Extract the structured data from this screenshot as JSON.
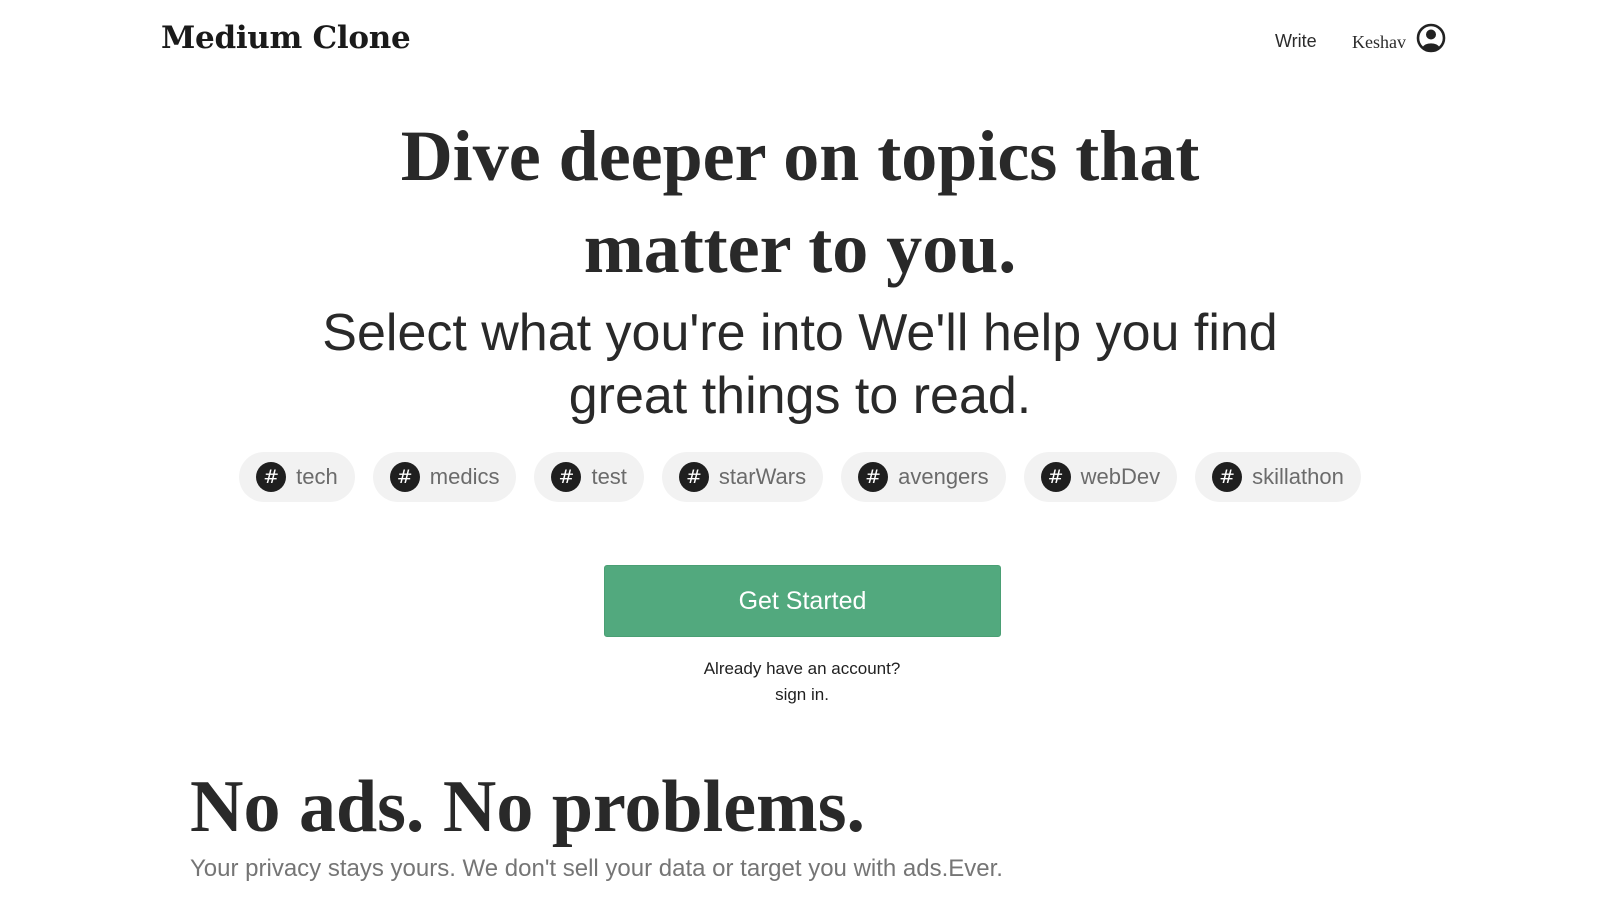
{
  "nav": {
    "brand": "Medium Clone",
    "write_label": "Write",
    "user_name": "Keshav",
    "avatar_icon": "user-circle-icon"
  },
  "hero": {
    "title": "Dive deeper on topics that matter to you.",
    "subtitle": "Select what you're into We'll help you find great things to read."
  },
  "tags": [
    {
      "icon": "#",
      "label": "tech"
    },
    {
      "icon": "#",
      "label": "medics"
    },
    {
      "icon": "#",
      "label": "test"
    },
    {
      "icon": "#",
      "label": "starWars"
    },
    {
      "icon": "#",
      "label": "avengers"
    },
    {
      "icon": "#",
      "label": "webDev"
    },
    {
      "icon": "#",
      "label": "skillathon"
    }
  ],
  "cta": {
    "label": "Get Started",
    "account_prompt": "Already have an account?",
    "signin_label": "sign in."
  },
  "section2": {
    "title": "No ads. No problems.",
    "text": "Your privacy stays yours. We don't sell your data or target you with ads.Ever."
  },
  "colors": {
    "accent_green": "#52a97e",
    "tag_background": "#f2f2f2",
    "text_dark": "#292929",
    "text_muted": "#757575"
  }
}
